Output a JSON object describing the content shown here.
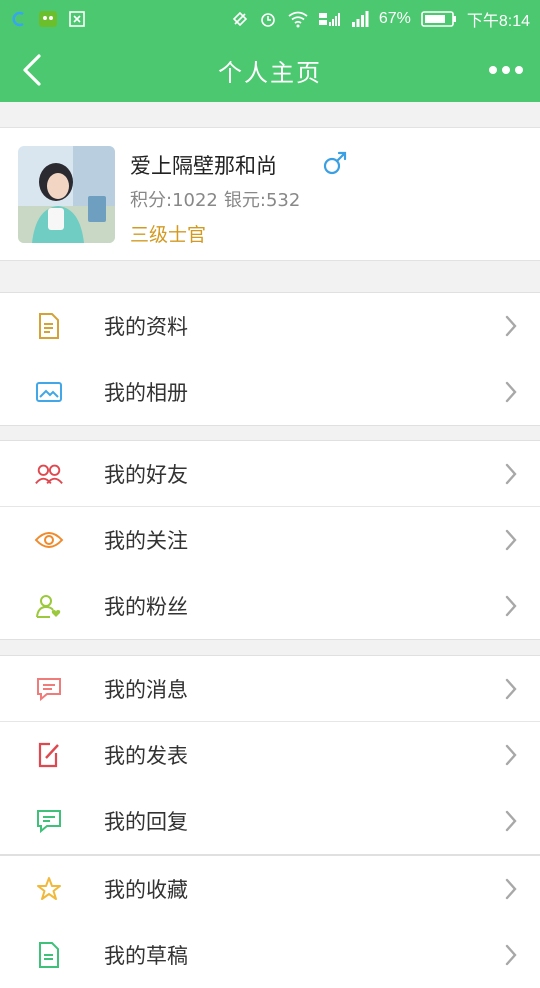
{
  "status_bar": {
    "battery_percent": "67%",
    "time": "下午8:14"
  },
  "nav": {
    "title": "个人主页"
  },
  "profile": {
    "name": "爱上隔壁那和尚",
    "gender_symbol": "♂",
    "points": "积分:1022",
    "silver": "银元:532",
    "rank": "三级士官"
  },
  "menu": {
    "group1": [
      {
        "label": "我的资料",
        "icon": "document-icon",
        "color": "#d4a237"
      },
      {
        "label": "我的相册",
        "icon": "photo-icon",
        "color": "#41a7e6"
      }
    ],
    "group2": [
      {
        "label": "我的好友",
        "icon": "friends-icon",
        "color": "#e0484f"
      },
      {
        "label": "我的关注",
        "icon": "eye-icon",
        "color": "#ef8a2d"
      },
      {
        "label": "我的粉丝",
        "icon": "fan-icon",
        "color": "#9bc93b"
      }
    ],
    "group3": [
      {
        "label": "我的消息",
        "icon": "message-icon",
        "color": "#f07b7b"
      },
      {
        "label": "我的发表",
        "icon": "edit-icon",
        "color": "#e0484f"
      },
      {
        "label": "我的回复",
        "icon": "reply-icon",
        "color": "#3fc17a"
      }
    ],
    "group4": [
      {
        "label": "我的收藏",
        "icon": "star-icon",
        "color": "#f0b93c"
      },
      {
        "label": "我的草稿",
        "icon": "draft-icon",
        "color": "#3fc17a"
      }
    ]
  },
  "colors": {
    "brand_green": "#4cc870",
    "rank_gold": "#d39a22"
  }
}
